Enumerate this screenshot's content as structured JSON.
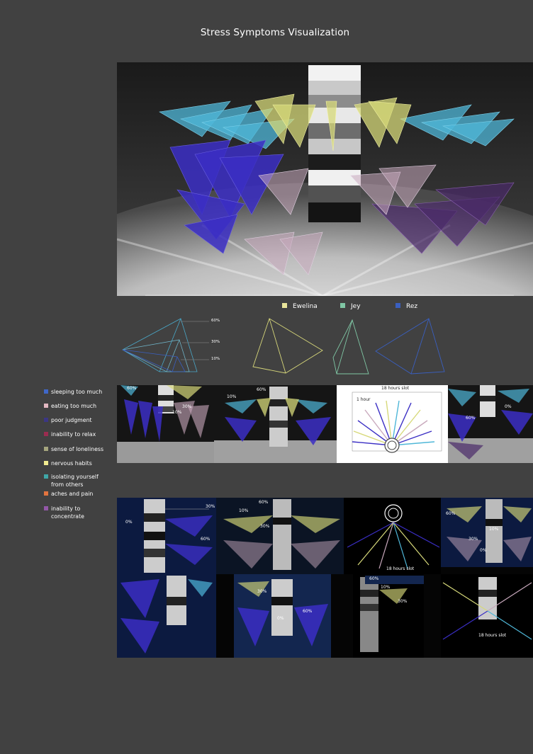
{
  "title": "Stress Symptoms Visualization",
  "people": [
    {
      "name": "Ewelina",
      "color": "#e9e59b"
    },
    {
      "name": "Jey",
      "color": "#7fc6a4"
    },
    {
      "name": "Rez",
      "color": "#3a5fbf"
    }
  ],
  "scale_labels": [
    "60%",
    "30%",
    "10%"
  ],
  "symptoms": [
    {
      "label": "sleeping too much",
      "color": "#3f67c8"
    },
    {
      "label": "eating too much",
      "color": "#e3b8c1"
    },
    {
      "label": "poor judgment",
      "color": "#3b3684"
    },
    {
      "label": "inability to relax",
      "color": "#9b2c50"
    },
    {
      "label": "sense of loneliness",
      "color": "#a5a57e"
    },
    {
      "label": "nervous habits",
      "color": "#f2ec90"
    },
    {
      "label": "isolating yourself from others",
      "color": "#3fa7a7"
    },
    {
      "label": "aches and pain",
      "color": "#e2743f"
    },
    {
      "label": "inability to concentrate",
      "color": "#9357a8"
    }
  ],
  "annotations": {
    "slot_18": "18 hours slot",
    "one_hour": "1 hour",
    "p60": "60%",
    "p30": "30%",
    "p10": "10%",
    "p0": "0%"
  }
}
